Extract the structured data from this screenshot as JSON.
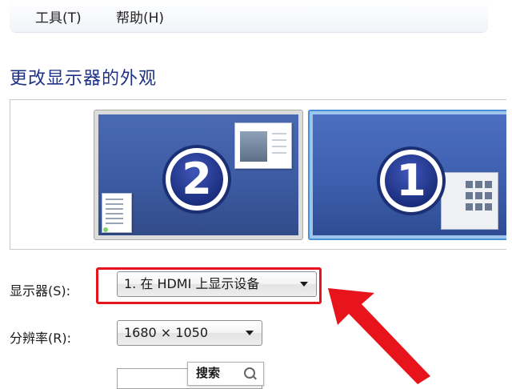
{
  "menu": {
    "tools": "工具(T)",
    "help": "帮助(H)"
  },
  "page_title": "更改显示器的外观",
  "preview": {
    "monitors": [
      {
        "number": "2",
        "selected": false
      },
      {
        "number": "1",
        "selected": true
      }
    ]
  },
  "settings": {
    "display_label": "显示器(S):",
    "display_value": "1. 在 HDMI 上显示设备",
    "resolution_label": "分辨率(R):",
    "resolution_value": "1680 × 1050"
  },
  "search": {
    "button_label": "搜索"
  },
  "colors": {
    "highlight": "#e8141c",
    "title": "#1e3287",
    "badge": "#1b2f7f"
  },
  "icons": [
    "chevron-down-icon",
    "search-icon",
    "red-arrow-annotation"
  ]
}
